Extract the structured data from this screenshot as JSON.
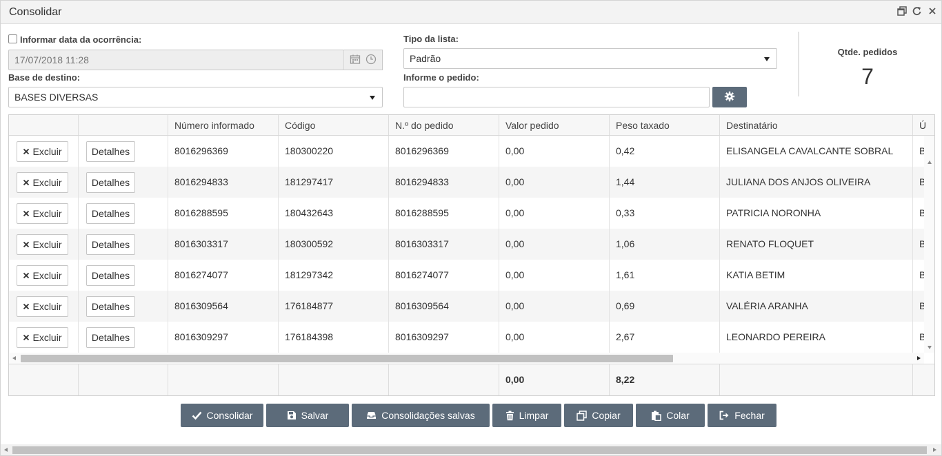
{
  "window": {
    "title": "Consolidar"
  },
  "form": {
    "informar_data_label": "Informar data da ocorrência:",
    "informar_data_checked": false,
    "data_value": "17/07/2018 11:28",
    "base_destino_label": "Base de destino:",
    "base_destino_value": "BASES DIVERSAS",
    "tipo_lista_label": "Tipo da lista:",
    "tipo_lista_value": "Padrão",
    "informe_pedido_label": "Informe o pedido:",
    "informe_pedido_value": "",
    "qtde_label": "Qtde. pedidos",
    "qtde_value": "7"
  },
  "grid": {
    "columns": [
      "",
      "",
      "Número informado",
      "Código",
      "N.º do pedido",
      "Valor pedido",
      "Peso taxado",
      "Destinatário",
      "Ú"
    ],
    "excluir_label": "Excluir",
    "detalhes_label": "Detalhes",
    "rows": [
      {
        "numero": "8016296369",
        "codigo": "180300220",
        "pedido": "8016296369",
        "valor": "0,00",
        "peso": "0,42",
        "destinatario": "ELISANGELA CAVALCANTE SOBRAL",
        "ultimo": "B"
      },
      {
        "numero": "8016294833",
        "codigo": "181297417",
        "pedido": "8016294833",
        "valor": "0,00",
        "peso": "1,44",
        "destinatario": "JULIANA DOS ANJOS OLIVEIRA",
        "ultimo": "B"
      },
      {
        "numero": "8016288595",
        "codigo": "180432643",
        "pedido": "8016288595",
        "valor": "0,00",
        "peso": "0,33",
        "destinatario": "PATRICIA NORONHA",
        "ultimo": "B"
      },
      {
        "numero": "8016303317",
        "codigo": "180300592",
        "pedido": "8016303317",
        "valor": "0,00",
        "peso": "1,06",
        "destinatario": "RENATO FLOQUET",
        "ultimo": "B"
      },
      {
        "numero": "8016274077",
        "codigo": "181297342",
        "pedido": "8016274077",
        "valor": "0,00",
        "peso": "1,61",
        "destinatario": "KATIA BETIM",
        "ultimo": "B"
      },
      {
        "numero": "8016309564",
        "codigo": "176184877",
        "pedido": "8016309564",
        "valor": "0,00",
        "peso": "0,69",
        "destinatario": "VALÉRIA ARANHA",
        "ultimo": "B"
      },
      {
        "numero": "8016309297",
        "codigo": "176184398",
        "pedido": "8016309297",
        "valor": "0,00",
        "peso": "2,67",
        "destinatario": "LEONARDO PEREIRA",
        "ultimo": "B"
      }
    ],
    "totals": {
      "valor": "0,00",
      "peso": "8,22"
    }
  },
  "actions": {
    "consolidar": "Consolidar",
    "salvar": "Salvar",
    "consolidacoes_salvas": "Consolidações salvas",
    "limpar": "Limpar",
    "copiar": "Copiar",
    "colar": "Colar",
    "fechar": "Fechar"
  },
  "colors": {
    "button_bg": "#5c6b7a",
    "alt_row_bg": "#f5f5f5"
  }
}
